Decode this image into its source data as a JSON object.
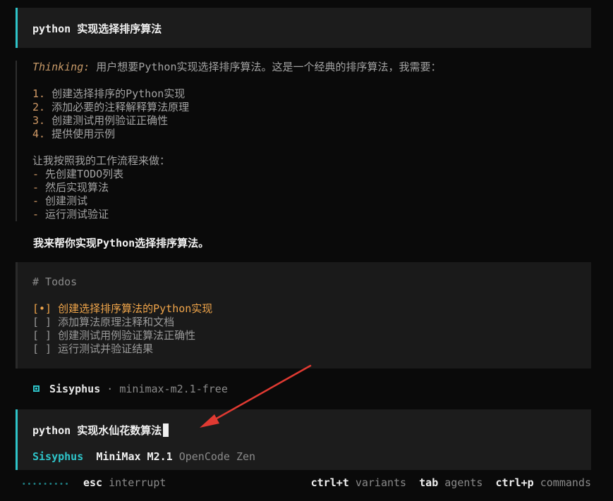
{
  "first_message": {
    "text": "python 实现选择排序算法"
  },
  "thinking": {
    "label": "Thinking:",
    "intro": " 用户想要Python实现选择排序算法。这是一个经典的排序算法，我需要：",
    "steps": [
      {
        "num": "1.",
        "text": " 创建选择排序的Python实现"
      },
      {
        "num": "2.",
        "text": " 添加必要的注释解释算法原理"
      },
      {
        "num": "3.",
        "text": " 创建测试用例验证正确性"
      },
      {
        "num": "4.",
        "text": " 提供使用示例"
      }
    ],
    "workflow_intro": "让我按照我的工作流程来做：",
    "workflow": [
      {
        "dash": "-",
        "text": " 先创建TODO列表"
      },
      {
        "dash": "-",
        "text": " 然后实现算法"
      },
      {
        "dash": "-",
        "text": " 创建测试"
      },
      {
        "dash": "-",
        "text": " 运行测试验证"
      }
    ]
  },
  "reply": {
    "text": "我来帮你实现Python选择排序算法。"
  },
  "todos": {
    "heading": "# Todos",
    "items": [
      {
        "text": "[•] 创建选择排序算法的Python实现"
      },
      {
        "text": "[ ] 添加算法原理注释和文档"
      },
      {
        "text": "[ ] 创建测试用例验证算法正确性"
      },
      {
        "text": "[ ] 运行测试并验证结果"
      }
    ]
  },
  "agent_line": {
    "name": "Sisyphus",
    "separator": " · ",
    "model": "minimax-m2.1-free"
  },
  "input": {
    "text": "python 实现水仙花数算法",
    "agent": "Sisyphus",
    "model": "MiniMax M2.1",
    "provider": "OpenCode Zen"
  },
  "status_bar": {
    "esc_key": "esc",
    "esc_hint": "interrupt",
    "shortcuts": [
      {
        "key": "ctrl+t",
        "hint": "variants"
      },
      {
        "key": "tab",
        "hint": "agents"
      },
      {
        "key": "ctrl+p",
        "hint": "commands"
      }
    ]
  },
  "colors": {
    "accent": "#2ec4c9",
    "thinking_label": "#c89a68",
    "list_marker": "#d19a66",
    "active_todo": "#f0a54a",
    "annotation_arrow": "#e03a32"
  }
}
